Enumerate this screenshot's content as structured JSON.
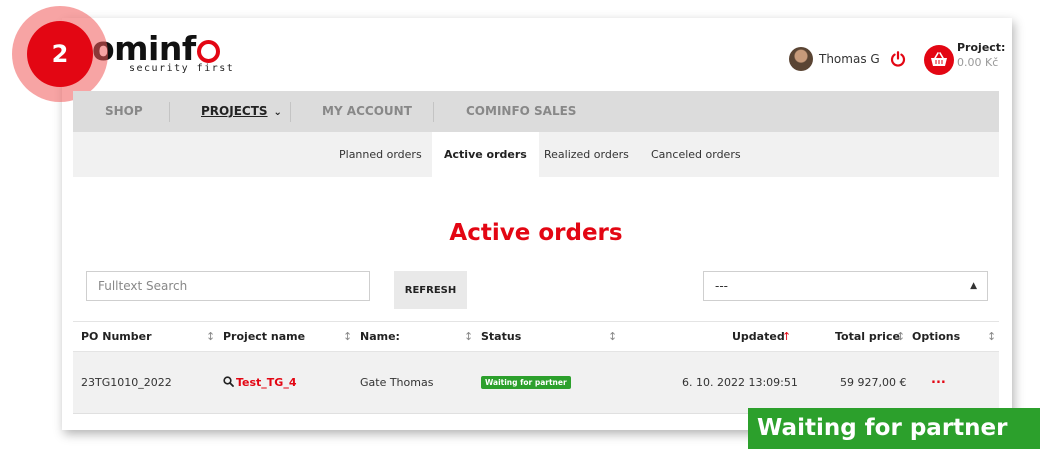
{
  "brand": {
    "logo_main": "ominf",
    "logo_tail": "",
    "tagline": "security first"
  },
  "step_badge": {
    "number": "2"
  },
  "header": {
    "user_name": "Thomas G",
    "project_label": "Project:",
    "project_value": "0.00 Kč"
  },
  "main_nav": {
    "items": [
      {
        "label": "SHOP",
        "active": false
      },
      {
        "label": "PROJECTS",
        "active": true
      },
      {
        "label": "MY ACCOUNT",
        "active": false
      },
      {
        "label": "COMINFO SALES",
        "active": false
      }
    ]
  },
  "sub_nav": {
    "items": [
      {
        "label": "Planned orders",
        "active": false
      },
      {
        "label": "Active orders",
        "active": true
      },
      {
        "label": "Realized orders",
        "active": false
      },
      {
        "label": "Canceled orders",
        "active": false
      }
    ]
  },
  "page": {
    "title": "Active orders"
  },
  "controls": {
    "search_placeholder": "Fulltext Search",
    "refresh_label": "REFRESH",
    "select_value": "---"
  },
  "table": {
    "columns": [
      "PO Number",
      "Project name",
      "Name:",
      "Status",
      "Updated",
      "Total price",
      "Options"
    ],
    "rows": [
      {
        "po_number": "23TG1010_2022",
        "project_name": "Test_TG_4",
        "name": "Gate Thomas",
        "status": "Waiting for partner",
        "updated": "6. 10. 2022 13:09:51",
        "total_price": "59 927,00 €",
        "options": "..."
      }
    ]
  },
  "callout": {
    "text": "Waiting for partner"
  },
  "colors": {
    "accent": "#e30613",
    "status_green": "#2ca02c",
    "nav_bg": "#dcdcdc",
    "subnav_bg": "#f1f1f1"
  }
}
